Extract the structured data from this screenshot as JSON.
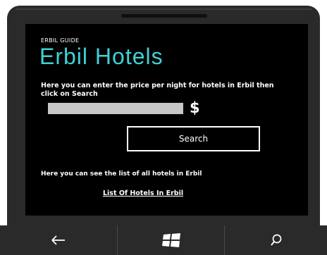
{
  "app": {
    "label": "ERBIL GUIDE",
    "title": "Erbil Hotels"
  },
  "price_form": {
    "instruction": "Here you can enter the price per night for hotels in Erbil then click on Search",
    "input_value": "",
    "input_placeholder": "",
    "currency_symbol": "$",
    "search_label": "Search"
  },
  "hotel_list": {
    "caption": "Here you can see the list of all hotels in Erbil",
    "link_label": "List Of Hotels In Erbil"
  },
  "nav_bar": {
    "buttons": [
      "back-icon",
      "windows-start-icon",
      "search-icon"
    ]
  },
  "colors": {
    "title_accent": "#3fd1d6",
    "screen_background": "#000000",
    "input_fill": "#c7c7c7"
  }
}
